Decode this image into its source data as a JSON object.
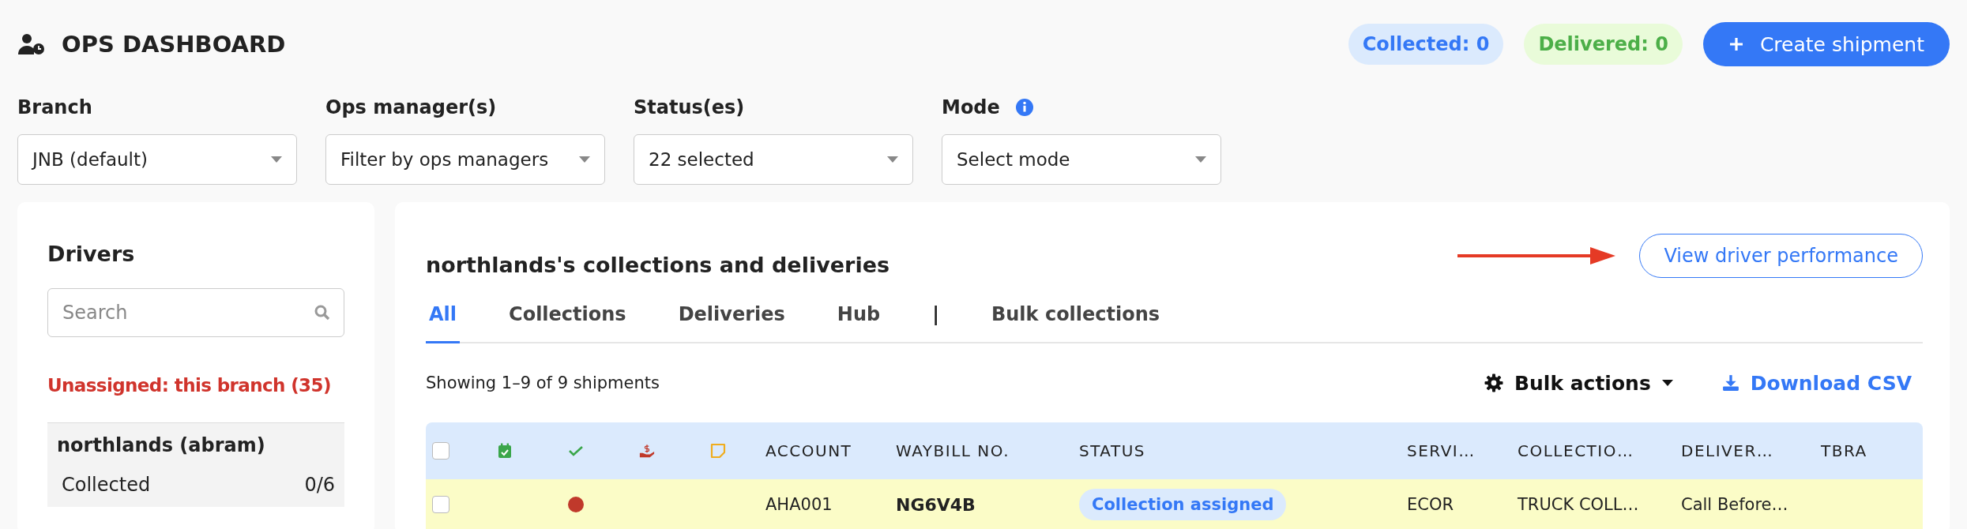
{
  "header": {
    "title": "OPS DASHBOARD",
    "counters": [
      {
        "label": "Collected: 0",
        "kind": "collected"
      },
      {
        "label": "Delivered: 0",
        "kind": "delivered"
      }
    ],
    "create_button": "Create shipment"
  },
  "filters": [
    {
      "label": "Branch",
      "value": "JNB (default)",
      "info": false
    },
    {
      "label": "Ops manager(s)",
      "placeholder": "Filter by ops managers",
      "info": false
    },
    {
      "label": "Status(es)",
      "value": "22 selected",
      "info": false
    },
    {
      "label": "Mode",
      "placeholder": "Select mode",
      "info": true
    }
  ],
  "drivers": {
    "title": "Drivers",
    "search": {
      "placeholder": "Search"
    },
    "unassigned": "Unassigned: this branch (35)",
    "items": [
      {
        "name": "northlands (abram)",
        "selected": true,
        "stats": [
          {
            "label": "Collected",
            "value": "0/6"
          }
        ]
      }
    ]
  },
  "main": {
    "title": "northlands's collections and deliveries",
    "performance_button": "View driver performance",
    "tabs": [
      {
        "label": "All",
        "selected": true,
        "kind": "tab"
      },
      {
        "label": "Collections",
        "selected": false,
        "kind": "tab"
      },
      {
        "label": "Deliveries",
        "selected": false,
        "kind": "tab"
      },
      {
        "label": "Hub",
        "selected": false,
        "kind": "tab"
      },
      {
        "label": "|",
        "kind": "separator"
      },
      {
        "label": "Bulk collections",
        "selected": false,
        "kind": "tab"
      }
    ],
    "showing": "Showing 1–9 of 9 shipments",
    "bulk_actions": "Bulk actions",
    "download": "Download CSV",
    "table": {
      "header_checked": false,
      "columns": [
        "ACCOUNT",
        "WAYBILL NO.",
        "STATUS",
        "SERVI…",
        "COLLECTIO…",
        "DELIVER…",
        "TBRA"
      ],
      "rows": [
        {
          "checked": false,
          "highlighted": true,
          "color": "#c0392b",
          "account": "AHA001",
          "waybill": "NG6V4B",
          "status": "Collection assigned",
          "service": "ECOR",
          "collection": "TRUCK COLL…",
          "delivery": "Call Before…"
        }
      ]
    }
  }
}
